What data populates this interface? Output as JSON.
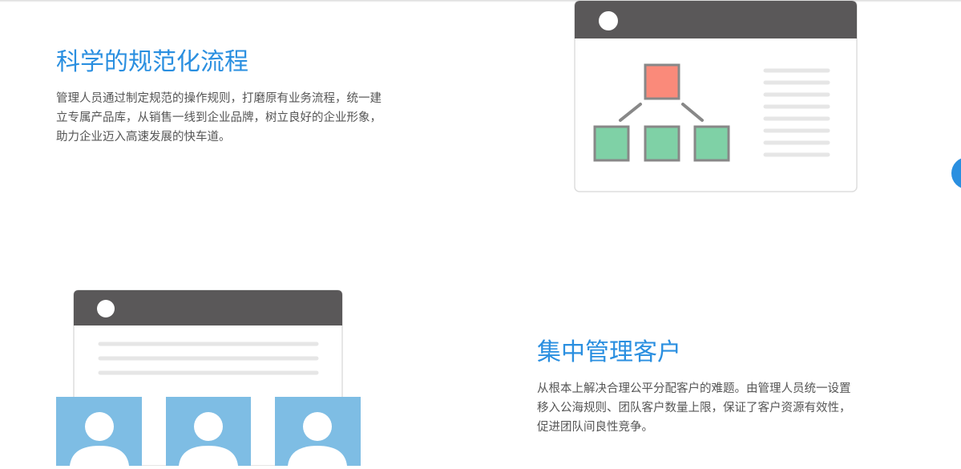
{
  "features": [
    {
      "title": "科学的规范化流程",
      "description": "管理人员通过制定规范的操作规则，打磨原有业务流程，统一建立专属产品库，从销售一线到企业品牌，树立良好的企业形象，助力企业迈入高速发展的快车道。"
    },
    {
      "title": "集中管理客户",
      "description": "从根本上解决合理公平分配客户的难题。由管理人员统一设置移入公海规则、团队客户数量上限，保证了客户资源有效性，促进团队间良性竞争。"
    }
  ],
  "colors": {
    "accent": "#2a8fe0",
    "window_header": "#5a5859",
    "node_root": "#fa8a7a",
    "node_child": "#7fd1a6",
    "card_blue": "#7ebde4"
  },
  "icons": {
    "flow": "org-chart-window-illustration",
    "customers": "customer-cards-illustration",
    "side": "floating-action-button"
  }
}
